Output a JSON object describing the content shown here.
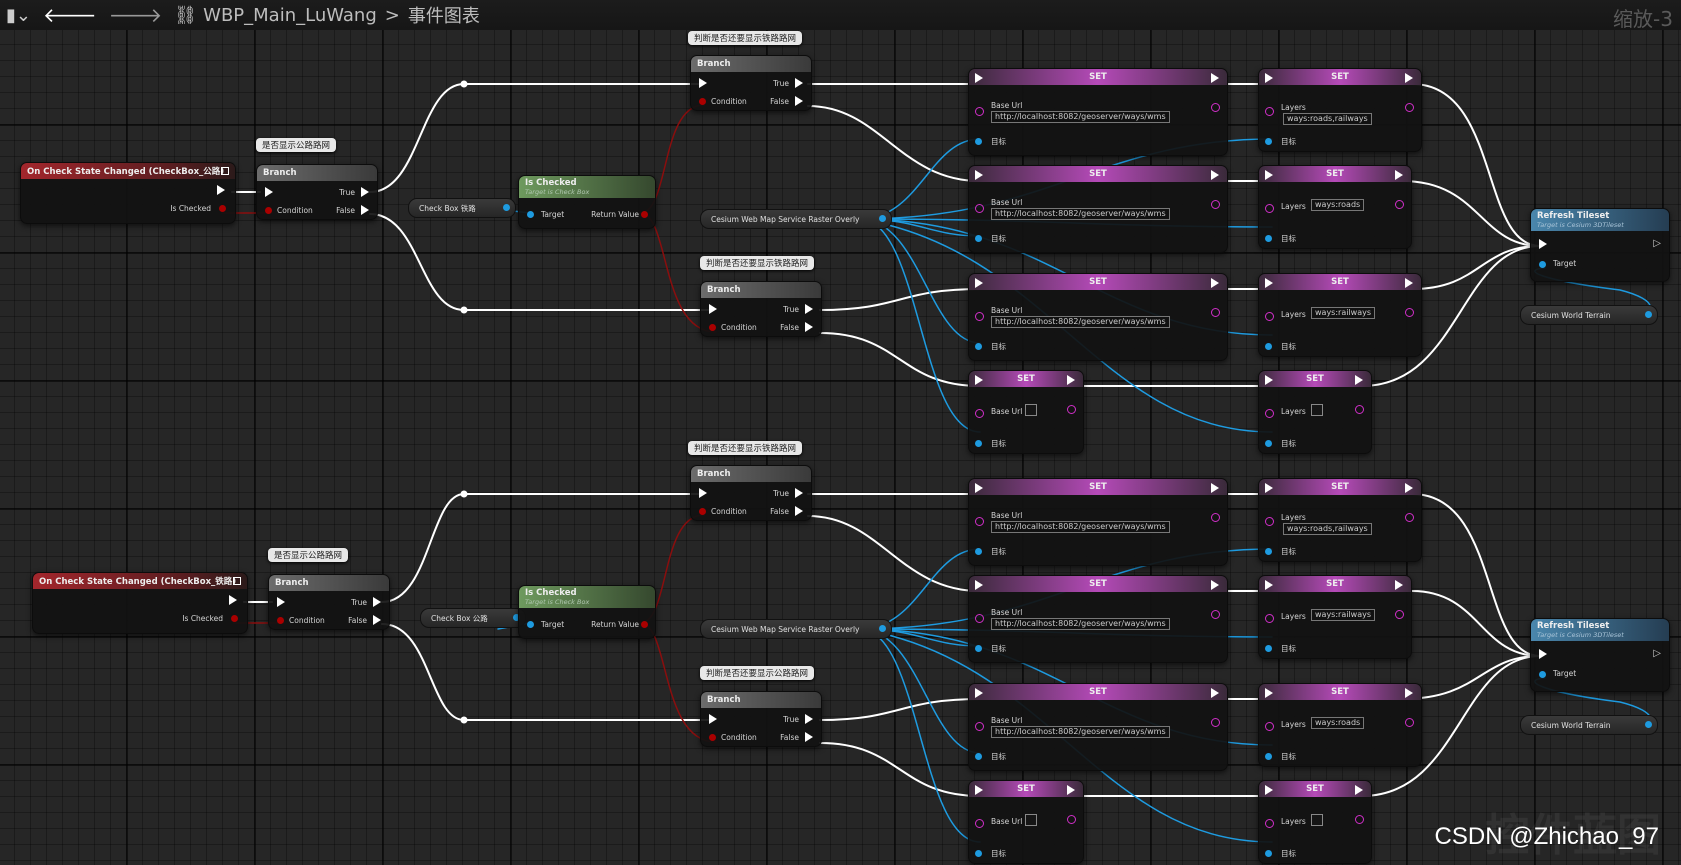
{
  "topbar": {
    "breadcrumb_asset": "WBP_Main_LuWang",
    "breadcrumb_sep": ">",
    "breadcrumb_graph": "事件图表",
    "zoom": "缩放-3"
  },
  "nodes": {
    "event_label": "On Check State Changed (CheckBox_公路)",
    "event2_label": "On Check State Changed (CheckBox_铁路)",
    "is_checked_pin": "Is Checked",
    "branch": "Branch",
    "true": "True",
    "false": "False",
    "condition": "Condition",
    "is_checked_func": "Is Checked",
    "is_checked_sub": "Target is Check Box",
    "target": "Target",
    "return_value": "Return Value",
    "set": "SET",
    "base_url": "Base Url",
    "layers": "Layers",
    "target_cn": "目标",
    "url_value": "http://localhost:8082/geoserver/ways/wms",
    "layers_roads_railways": "ways:roads,railways",
    "layers_roads": "ways:roads",
    "layers_railways": "ways:railways",
    "refresh": "Refresh Tileset",
    "refresh_sub": "Target is Cesium 3DTileset",
    "var_checkbox_rail": "Check Box 铁路",
    "var_checkbox_road": "Check Box 公路",
    "var_wms": "Cesium Web Map Service Raster Overly",
    "var_terrain": "Cesium World Terrain"
  },
  "comments": {
    "c_road": "是否显示公路路网",
    "c_rail_q": "判断是否还要显示铁路路网",
    "c_road_q": "判断是否还要显示公路路网"
  },
  "watermark": "CSDN @Zhichao_97",
  "watermark_bg": "控件蓝图"
}
